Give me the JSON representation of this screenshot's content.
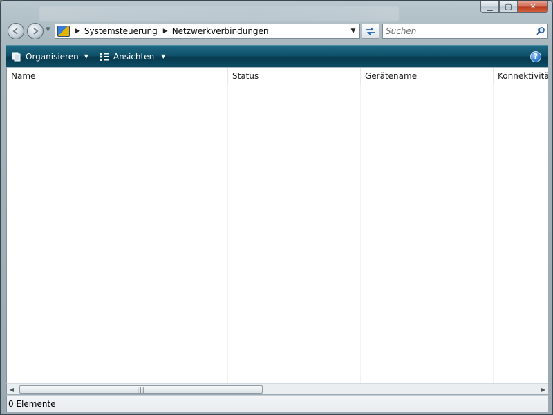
{
  "window": {
    "caption_minimize": "▁",
    "caption_maximize": "▢",
    "caption_close": "✕"
  },
  "navigation": {
    "back_icon": "back-arrow-icon",
    "forward_icon": "forward-arrow-icon",
    "history_dropdown_icon": "chevron-down-icon"
  },
  "address_bar": {
    "icon": "control-panel-icon",
    "breadcrumbs": [
      "Systemsteuerung",
      "Netzwerkverbindungen"
    ]
  },
  "search": {
    "placeholder": "Suchen"
  },
  "toolbar": {
    "organize_label": "Organisieren",
    "views_label": "Ansichten",
    "help_label": "?"
  },
  "list": {
    "columns": [
      "Name",
      "Status",
      "Gerätename",
      "Konnektivität"
    ],
    "items": []
  },
  "scrollbar": {
    "thumb_grip": "|||"
  },
  "status_bar": {
    "text": "0 Elemente"
  },
  "colors": {
    "toolbar_bg": "#0e4d66",
    "close_button": "#c84a2e",
    "window_frame": "#a7b5bd"
  }
}
